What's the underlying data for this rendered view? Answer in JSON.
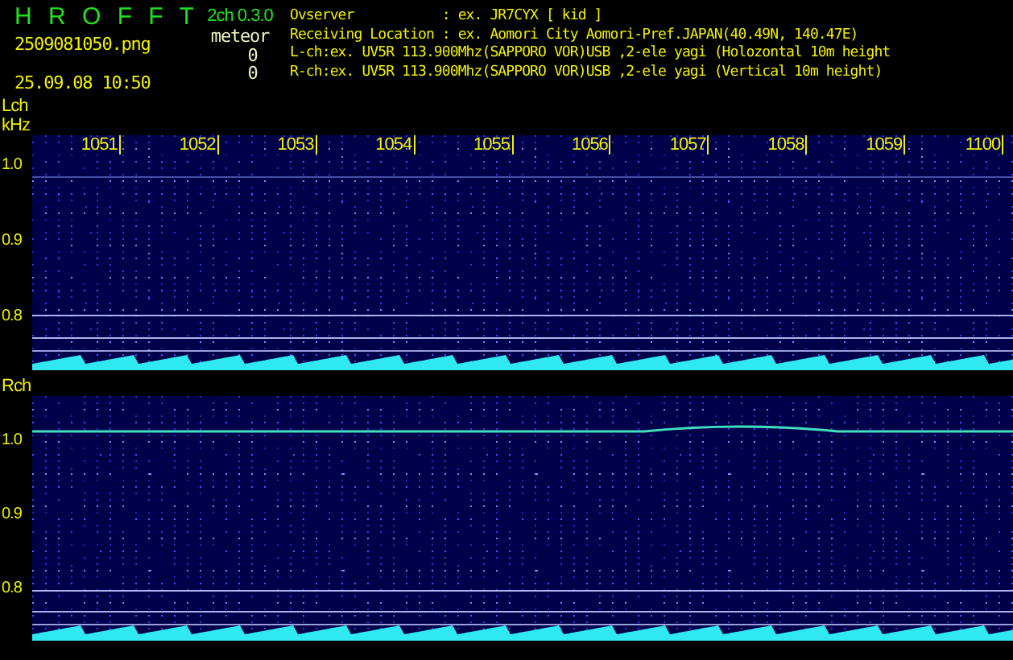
{
  "header": {
    "title": "H R O F F T",
    "version": "2ch 0.3.0",
    "filename": "2509081050.png",
    "datetime": "25.09.08 10:50",
    "counter_label": "meteor",
    "counts": [
      "0",
      "0"
    ],
    "info_lines": [
      "Ovserver           : ex. JR7CYX [ kid ]",
      "Receiving Location : ex. Aomori City Aomori-Pref.JAPAN(40.49N, 140.47E)",
      "L-ch:ex. UV5R 113.900Mhz(SAPPORO VOR)USB ,2-ele yagi (Holozontal 10m height",
      "R-ch:ex. UV5R 113.900Mhz(SAPPORO VOR)USB ,2-ele yagi (Vertical 10m height)"
    ]
  },
  "channels": [
    {
      "kind": "left",
      "label": "Lch",
      "unit": "kHz",
      "time_labels": [
        "1051",
        "1052",
        "1053",
        "1054",
        "1055",
        "1056",
        "1057",
        "1058",
        "1059",
        "1100"
      ],
      "y_labels": [
        "1.0",
        "0.9",
        "0.8"
      ]
    },
    {
      "kind": "right",
      "label": "Rch",
      "y_labels": [
        "1.0",
        "0.9",
        "0.8"
      ]
    }
  ]
}
